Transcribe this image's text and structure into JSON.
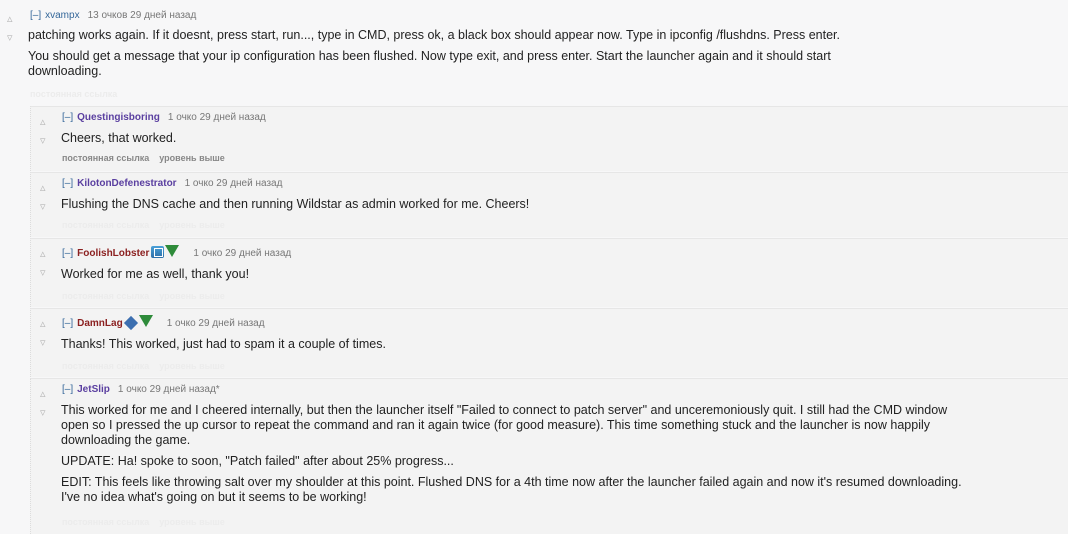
{
  "parent": {
    "toggle": "[–]",
    "author": "xvampx",
    "score": "13 очков 29 дней назад",
    "paragraphs": [
      "patching works again. If it doesnt, press start, run..., type in CMD, press ok, a black box should appear now. Type in ipconfig /flushdns. Press enter.",
      "You should get a message that your ip configuration has been flushed. Now type exit, and press enter. Start the launcher again and it should start downloading."
    ],
    "permalink": "постоянная ссылка"
  },
  "replies": [
    {
      "toggle": "[–]",
      "author": "Questingisboring",
      "score": "1 очко 29 дней назад",
      "paragraphs": [
        "Cheers, that worked."
      ],
      "permalink": "постоянная ссылка",
      "parent_link": "уровень выше"
    },
    {
      "toggle": "[–]",
      "author": "KilotonDefenestrator",
      "score": "1 очко 29 дней назад",
      "paragraphs": [
        "Flushing the DNS cache and then running Wildstar as admin worked for me. Cheers!"
      ],
      "permalink": "постоянная ссылка",
      "parent_link": "уровень выше"
    },
    {
      "toggle": "[–]",
      "author": "FoolishLobster",
      "score": "1 очко 29 дней назад",
      "paragraphs": [
        "Worked for me as well, thank you!"
      ],
      "permalink": "постоянная ссылка",
      "parent_link": "уровень выше"
    },
    {
      "toggle": "[–]",
      "author": "DamnLag",
      "score": "1 очко 29 дней назад",
      "paragraphs": [
        "Thanks! This worked, just had to spam it a couple of times."
      ],
      "permalink": "постоянная ссылка",
      "parent_link": "уровень выше"
    },
    {
      "toggle": "[–]",
      "author": "JetSlip",
      "score": "1 очко 29 дней назад*",
      "paragraphs": [
        "This worked for me and I cheered internally, but then the launcher itself \"Failed to connect to patch server\" and unceremoniously quit. I still had the CMD window open so I pressed the up cursor to repeat the command and ran it again twice (for good measure). This time something stuck and the launcher is now happily downloading the game.",
        "UPDATE: Ha! spoke to soon, \"Patch failed\" after about 25% progress...",
        "EDIT: This feels like throwing salt over my shoulder at this point. Flushed DNS for a 4th time now after the launcher failed again and now it's resumed downloading. I've no idea what's going on but it seems to be working!"
      ],
      "permalink": "постоянная ссылка",
      "parent_link": "уровень выше"
    }
  ],
  "icons": {
    "upvote": "▵",
    "downvote": "▿"
  }
}
